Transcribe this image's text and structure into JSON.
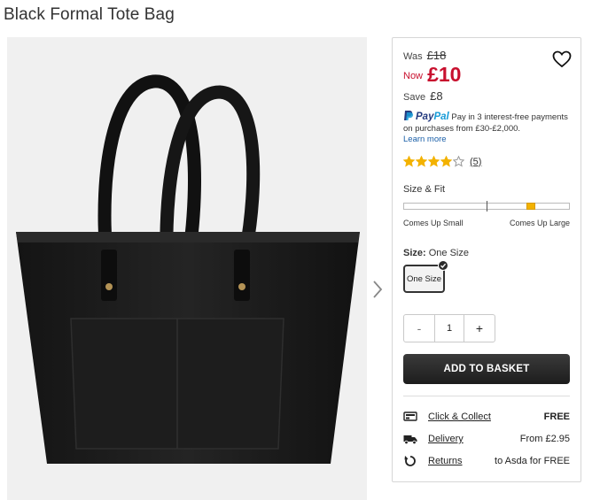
{
  "product": {
    "title": "Black Formal Tote Bag"
  },
  "pricing": {
    "was_label": "Was",
    "was_price": "£18",
    "now_label": "Now",
    "now_price": "£10",
    "save_label": "Save",
    "save_amount": "£8",
    "sale_color": "#c8102e"
  },
  "paypal": {
    "brand_pay": "Pay",
    "brand_pal": "Pal",
    "message": "Pay in 3 interest-free payments on purchases from £30-£2,000.",
    "learn_more": "Learn more"
  },
  "rating": {
    "stars": 4,
    "max": 5,
    "count": "(5)",
    "star_color": "#f3b200"
  },
  "fit": {
    "label": "Size & Fit",
    "left_label": "Comes Up Small",
    "right_label": "Comes Up Large",
    "position": 0.77
  },
  "size": {
    "label_prefix": "Size:",
    "selected": "One Size",
    "option": "One Size"
  },
  "quantity": {
    "minus": "-",
    "value": "1",
    "plus": "+"
  },
  "basket_label": "ADD TO BASKET",
  "fulfilment": [
    {
      "icon": "click-collect-icon",
      "label": "Click & Collect",
      "value": "FREE"
    },
    {
      "icon": "delivery-truck-icon",
      "label": "Delivery",
      "value": "From £2.95"
    },
    {
      "icon": "returns-icon",
      "label": "Returns",
      "value": "to Asda for FREE"
    }
  ]
}
